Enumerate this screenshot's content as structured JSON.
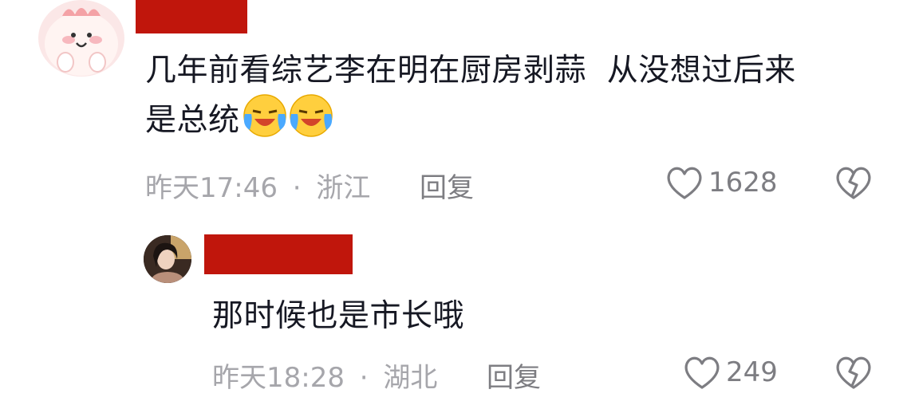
{
  "comments": [
    {
      "text_line1": "几年前看综艺李在明在厨房剥蒜  从没想过后来",
      "text_line2": "是总统",
      "emoji": [
        "😭",
        "😭"
      ],
      "time": "昨天17:46",
      "separator": "·",
      "location": "浙江",
      "reply_label": "回复",
      "likes": "1628",
      "icons": {
        "like": "heart-outline-icon",
        "dislike": "broken-heart-icon"
      }
    },
    {
      "text": "那时候也是市长哦",
      "time": "昨天18:28",
      "separator": "·",
      "location": "湖北",
      "reply_label": "回复",
      "likes": "249",
      "icons": {
        "like": "heart-outline-icon",
        "dislike": "broken-heart-icon"
      }
    }
  ],
  "colors": {
    "redaction": "#c0160c",
    "meta_text": "#a6a6ab",
    "icon": "#7d7d82"
  }
}
